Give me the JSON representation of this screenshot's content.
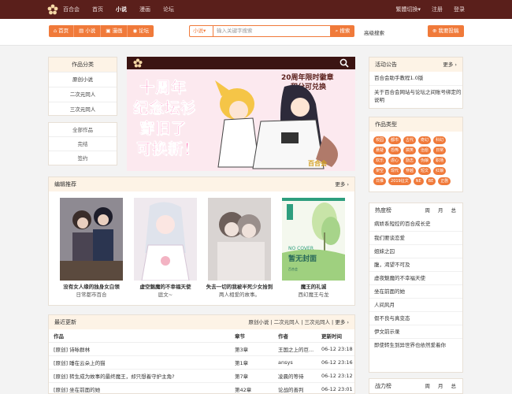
{
  "topbar": {
    "brand": "百合会",
    "nav": [
      "首页",
      "小说",
      "漫画",
      "论坛"
    ],
    "active": "小说",
    "right": [
      "繁體切換",
      "注册",
      "登录"
    ],
    "right_caret": "▾"
  },
  "subbar": {
    "pills": [
      {
        "icon": "home-icon",
        "label": "首页"
      },
      {
        "icon": "book-icon",
        "label": "小说"
      },
      {
        "icon": "picture-icon",
        "label": "漫画"
      },
      {
        "icon": "chat-icon",
        "label": "论坛"
      }
    ],
    "search_scope": "小说▾",
    "search_placeholder": "输入关键字搜索",
    "search_button": "搜索",
    "advanced": "高级搜索",
    "submit": "我要投稿"
  },
  "categories": {
    "title": "作品分类",
    "items": [
      "原创小说",
      "二次元同人",
      "三次元同人"
    ]
  },
  "filters": [
    "全部作品",
    "完结",
    "签约"
  ],
  "banner": {
    "headline": [
      "十周年",
      "纪念坛衫",
      "穿旧了",
      "可换新！"
    ],
    "subhead": [
      "20周年限时徽章",
      "积分可兑换"
    ],
    "caption": "百合会"
  },
  "editor": {
    "title": "编辑推荐",
    "more": "更多",
    "books": [
      {
        "title": "没有女人缘的独身女白领",
        "author": "日常都市百合"
      },
      {
        "title": "虚空魅魔的不幸福天使",
        "author": "庭文~"
      },
      {
        "title": "失去一切的我被半死少女拾到",
        "author": "两人相爱的故事。"
      },
      {
        "title": "魔王的礼诚",
        "author": "西幻魔王与龙"
      }
    ],
    "no_cover": [
      "NO COVER",
      "暂无封面",
      "百合会"
    ]
  },
  "latest": {
    "title": "最近更新",
    "filters": [
      "原创小说",
      "二次元同人",
      "三次元同人"
    ],
    "more": "更多",
    "columns": [
      "作品",
      "章节",
      "作者",
      "更新时间"
    ],
    "rows": [
      [
        "[原创] 诗咏群林",
        "第3章",
        "王国之上的巨...",
        "06-12 23:18"
      ],
      [
        "[原创] 睡在云朵上的猫",
        "第1章",
        "ansys",
        "06-12 23:16"
      ],
      [
        "[原创] 转生成为故事的最终魔王，却只想着守护主角?",
        "第7章",
        "凌晨的等待",
        "06-12 23:12"
      ],
      [
        "[原创] 坐在前面的她",
        "第42章",
        "论战的善判",
        "06-12 23:01"
      ]
    ]
  },
  "notice": {
    "title": "活动公告",
    "more": "更多",
    "items": [
      "百合会助手教程1.0版",
      "关于百合会网站与论坛之间账号绑定的说明"
    ]
  },
  "types": {
    "title": "作品类型",
    "tags": [
      "校园",
      "都市",
      "古代",
      "奇幻",
      "科幻",
      "悬疑",
      "恐怖",
      "搞笑",
      "治愈",
      "日常",
      "欢乐",
      "虐心",
      "励志",
      "伪娘",
      "职场",
      "架空",
      "现代",
      "穿越",
      "短文",
      "红娘",
      "日推",
      "2019征文",
      "NE",
      "BE",
      "正剧"
    ]
  },
  "hot": {
    "title": "热度榜",
    "tabs": [
      "周",
      "月",
      "总"
    ],
    "items": [
      "病娇系短控的百合成长史",
      "我们要谈恋爱",
      "姐妹之囚",
      "腹，渴望不可及",
      "虚夜魅魔的不幸福天使",
      "坐在前面的她",
      "人间风月",
      "假不良与真变态",
      "伊文前示录",
      "即使转生到异世界也依然爱着你"
    ]
  },
  "power": {
    "title": "战力榜",
    "tabs": [
      "周",
      "月",
      "总"
    ]
  },
  "colors": {
    "accent": "#f07a3a",
    "topbar": "#5a1f1b",
    "pink": "#ff2f8f"
  }
}
